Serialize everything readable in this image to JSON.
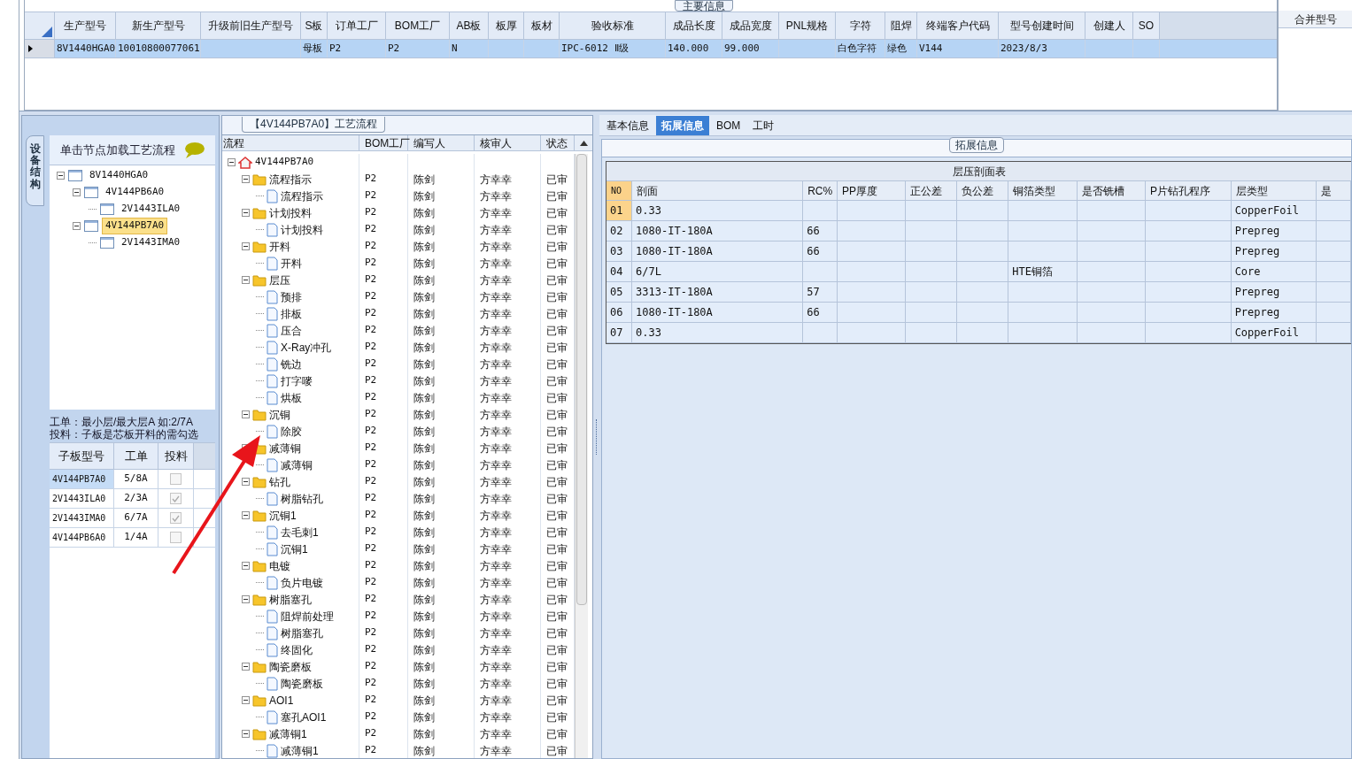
{
  "main_info": {
    "title": "主要信息",
    "columns": [
      "生产型号",
      "新生产型号",
      "升级前旧生产型号",
      "S板",
      "订单工厂",
      "BOM工厂",
      "AB板",
      "板厚",
      "板材",
      "验收标准",
      "成品长度",
      "成品宽度",
      "PNL规格",
      "字符",
      "阻焊",
      "终端客户代码",
      "型号创建时间",
      "创建人",
      "SO"
    ],
    "rows": [
      {
        "selected": true,
        "cells": [
          "8V1440HGA0",
          "10010800077061",
          null,
          "母板",
          "P2",
          "P2",
          "N",
          null,
          null,
          "IPC-6012 Ⅱ级",
          "140.000",
          "99.000",
          null,
          "白色字符",
          "绿色",
          "V144",
          "2023/8/3",
          null,
          null
        ]
      }
    ],
    "merge_column": "合并型号"
  },
  "structure_panel": {
    "side_tab": "设备结构",
    "hint": "单击节点加载工艺流程",
    "tree": [
      {
        "label": "8V1440HGA0",
        "selected": false,
        "expanded": true,
        "children": [
          {
            "label": "4V144PB6A0",
            "selected": false,
            "expanded": true,
            "children": [
              {
                "label": "2V1443ILA0",
                "selected": false
              }
            ]
          },
          {
            "label": "4V144PB7A0",
            "selected": true,
            "expanded": true,
            "children": [
              {
                "label": "2V1443IMA0",
                "selected": false
              }
            ]
          }
        ]
      }
    ],
    "notes": [
      "工单：最小层/最大层A 如:2/7A",
      "投料：子板是芯板开料的需勾选"
    ],
    "columns": [
      "子板型号",
      "工单",
      "投料"
    ],
    "rows": [
      {
        "board": "4V144PB7A0",
        "order": "5/8A",
        "feed": false,
        "selected": true
      },
      {
        "board": "2V1443ILA0",
        "order": "2/3A",
        "feed": true,
        "selected": false
      },
      {
        "board": "2V1443IMA0",
        "order": "6/7A",
        "feed": true,
        "selected": false
      },
      {
        "board": "4V144PB6A0",
        "order": "1/4A",
        "feed": false,
        "selected": false
      }
    ]
  },
  "process_panel": {
    "title": "【4V144PB7A0】工艺流程",
    "columns": [
      "流程",
      "BOM工厂",
      "编写人",
      "核审人",
      "状态"
    ],
    "tree": [
      {
        "kind": "root",
        "label": "4V144PB7A0",
        "expanded": true,
        "children": [
          {
            "kind": "folder",
            "label": "流程指示",
            "expanded": true,
            "bom": "P2",
            "writer": "陈剑",
            "reviewer": "方幸幸",
            "status": "已审",
            "children": [
              {
                "kind": "step",
                "label": "流程指示",
                "bom": "P2",
                "writer": "陈剑",
                "reviewer": "方幸幸",
                "status": "已审"
              }
            ]
          },
          {
            "kind": "folder",
            "label": "计划投料",
            "expanded": true,
            "bom": "P2",
            "writer": "陈剑",
            "reviewer": "方幸幸",
            "status": "已审",
            "children": [
              {
                "kind": "step",
                "label": "计划投料",
                "bom": "P2",
                "writer": "陈剑",
                "reviewer": "方幸幸",
                "status": "已审"
              }
            ]
          },
          {
            "kind": "folder",
            "label": "开料",
            "expanded": true,
            "bom": "P2",
            "writer": "陈剑",
            "reviewer": "方幸幸",
            "status": "已审",
            "children": [
              {
                "kind": "step",
                "label": "开料",
                "bom": "P2",
                "writer": "陈剑",
                "reviewer": "方幸幸",
                "status": "已审"
              }
            ]
          },
          {
            "kind": "folder",
            "label": "层压",
            "expanded": true,
            "bom": "P2",
            "writer": "陈剑",
            "reviewer": "方幸幸",
            "status": "已审",
            "children": [
              {
                "kind": "step",
                "label": "预排",
                "bom": "P2",
                "writer": "陈剑",
                "reviewer": "方幸幸",
                "status": "已审"
              },
              {
                "kind": "step",
                "label": "排板",
                "bom": "P2",
                "writer": "陈剑",
                "reviewer": "方幸幸",
                "status": "已审"
              },
              {
                "kind": "step",
                "label": "压合",
                "bom": "P2",
                "writer": "陈剑",
                "reviewer": "方幸幸",
                "status": "已审"
              },
              {
                "kind": "step",
                "label": "X-Ray冲孔",
                "bom": "P2",
                "writer": "陈剑",
                "reviewer": "方幸幸",
                "status": "已审"
              },
              {
                "kind": "step",
                "label": "铣边",
                "bom": "P2",
                "writer": "陈剑",
                "reviewer": "方幸幸",
                "status": "已审"
              },
              {
                "kind": "step",
                "label": "打字嘜",
                "bom": "P2",
                "writer": "陈剑",
                "reviewer": "方幸幸",
                "status": "已审"
              },
              {
                "kind": "step",
                "label": "烘板",
                "bom": "P2",
                "writer": "陈剑",
                "reviewer": "方幸幸",
                "status": "已审"
              }
            ]
          },
          {
            "kind": "folder",
            "label": "沉铜",
            "expanded": true,
            "bom": "P2",
            "writer": "陈剑",
            "reviewer": "方幸幸",
            "status": "已审",
            "children": [
              {
                "kind": "step",
                "label": "除胶",
                "bom": "P2",
                "writer": "陈剑",
                "reviewer": "方幸幸",
                "status": "已审"
              }
            ]
          },
          {
            "kind": "folder",
            "label": "减薄铜",
            "expanded": true,
            "bom": "P2",
            "writer": "陈剑",
            "reviewer": "方幸幸",
            "status": "已审",
            "children": [
              {
                "kind": "step",
                "label": "减薄铜",
                "bom": "P2",
                "writer": "陈剑",
                "reviewer": "方幸幸",
                "status": "已审"
              }
            ]
          },
          {
            "kind": "folder",
            "label": "钻孔",
            "expanded": true,
            "bom": "P2",
            "writer": "陈剑",
            "reviewer": "方幸幸",
            "status": "已审",
            "children": [
              {
                "kind": "step",
                "label": "树脂钻孔",
                "bom": "P2",
                "writer": "陈剑",
                "reviewer": "方幸幸",
                "status": "已审"
              }
            ]
          },
          {
            "kind": "folder",
            "label": "沉铜1",
            "expanded": true,
            "bom": "P2",
            "writer": "陈剑",
            "reviewer": "方幸幸",
            "status": "已审",
            "children": [
              {
                "kind": "step",
                "label": "去毛刺1",
                "bom": "P2",
                "writer": "陈剑",
                "reviewer": "方幸幸",
                "status": "已审"
              },
              {
                "kind": "step",
                "label": "沉铜1",
                "bom": "P2",
                "writer": "陈剑",
                "reviewer": "方幸幸",
                "status": "已审"
              }
            ]
          },
          {
            "kind": "folder",
            "label": "电镀",
            "expanded": true,
            "bom": "P2",
            "writer": "陈剑",
            "reviewer": "方幸幸",
            "status": "已审",
            "children": [
              {
                "kind": "step",
                "label": "负片电镀",
                "bom": "P2",
                "writer": "陈剑",
                "reviewer": "方幸幸",
                "status": "已审"
              }
            ]
          },
          {
            "kind": "folder",
            "label": "树脂塞孔",
            "expanded": true,
            "bom": "P2",
            "writer": "陈剑",
            "reviewer": "方幸幸",
            "status": "已审",
            "children": [
              {
                "kind": "step",
                "label": "阻焊前处理",
                "bom": "P2",
                "writer": "陈剑",
                "reviewer": "方幸幸",
                "status": "已审"
              },
              {
                "kind": "step",
                "label": "树脂塞孔",
                "bom": "P2",
                "writer": "陈剑",
                "reviewer": "方幸幸",
                "status": "已审"
              },
              {
                "kind": "step",
                "label": "终固化",
                "bom": "P2",
                "writer": "陈剑",
                "reviewer": "方幸幸",
                "status": "已审"
              }
            ]
          },
          {
            "kind": "folder",
            "label": "陶瓷磨板",
            "expanded": true,
            "bom": "P2",
            "writer": "陈剑",
            "reviewer": "方幸幸",
            "status": "已审",
            "children": [
              {
                "kind": "step",
                "label": "陶瓷磨板",
                "bom": "P2",
                "writer": "陈剑",
                "reviewer": "方幸幸",
                "status": "已审"
              }
            ]
          },
          {
            "kind": "folder",
            "label": "AOI1",
            "expanded": true,
            "bom": "P2",
            "writer": "陈剑",
            "reviewer": "方幸幸",
            "status": "已审",
            "children": [
              {
                "kind": "step",
                "label": "塞孔AOI1",
                "bom": "P2",
                "writer": "陈剑",
                "reviewer": "方幸幸",
                "status": "已审"
              }
            ]
          },
          {
            "kind": "folder",
            "label": "减薄铜1",
            "expanded": true,
            "bom": "P2",
            "writer": "陈剑",
            "reviewer": "方幸幸",
            "status": "已审",
            "children": [
              {
                "kind": "step",
                "label": "减薄铜1",
                "bom": "P2",
                "writer": "陈剑",
                "reviewer": "方幸幸",
                "status": "已审"
              }
            ]
          }
        ]
      }
    ]
  },
  "detail_panel": {
    "tabs": [
      {
        "label": "基本信息",
        "selected": false
      },
      {
        "label": "拓展信息",
        "selected": true
      },
      {
        "label": "BOM",
        "selected": false
      },
      {
        "label": "工时",
        "selected": false
      }
    ],
    "group_title": "拓展信息",
    "table_title": "层压剖面表",
    "columns": [
      "NO",
      "剖面",
      "RC%",
      "PP厚度",
      "正公差",
      "负公差",
      "铜箔类型",
      "是否铣槽",
      "P片钻孔程序",
      "层类型",
      "是"
    ],
    "rows": [
      {
        "selected": true,
        "cells": [
          "01",
          "0.33",
          null,
          null,
          null,
          null,
          null,
          null,
          null,
          "CopperFoil",
          null
        ]
      },
      {
        "selected": false,
        "cells": [
          "02",
          "1080-IT-180A",
          "66",
          null,
          null,
          null,
          null,
          null,
          null,
          "Prepreg",
          null
        ]
      },
      {
        "selected": false,
        "cells": [
          "03",
          "1080-IT-180A",
          "66",
          null,
          null,
          null,
          null,
          null,
          null,
          "Prepreg",
          null
        ]
      },
      {
        "selected": false,
        "cells": [
          "04",
          "6/7L",
          null,
          null,
          null,
          null,
          "HTE铜箔",
          null,
          null,
          "Core",
          null
        ]
      },
      {
        "selected": false,
        "cells": [
          "05",
          "3313-IT-180A",
          "57",
          null,
          null,
          null,
          null,
          null,
          null,
          "Prepreg",
          null
        ]
      },
      {
        "selected": false,
        "cells": [
          "06",
          "1080-IT-180A",
          "66",
          null,
          null,
          null,
          null,
          null,
          null,
          "Prepreg",
          null
        ]
      },
      {
        "selected": false,
        "cells": [
          "07",
          "0.33",
          null,
          null,
          null,
          null,
          null,
          null,
          null,
          "CopperFoil",
          null
        ]
      }
    ]
  }
}
